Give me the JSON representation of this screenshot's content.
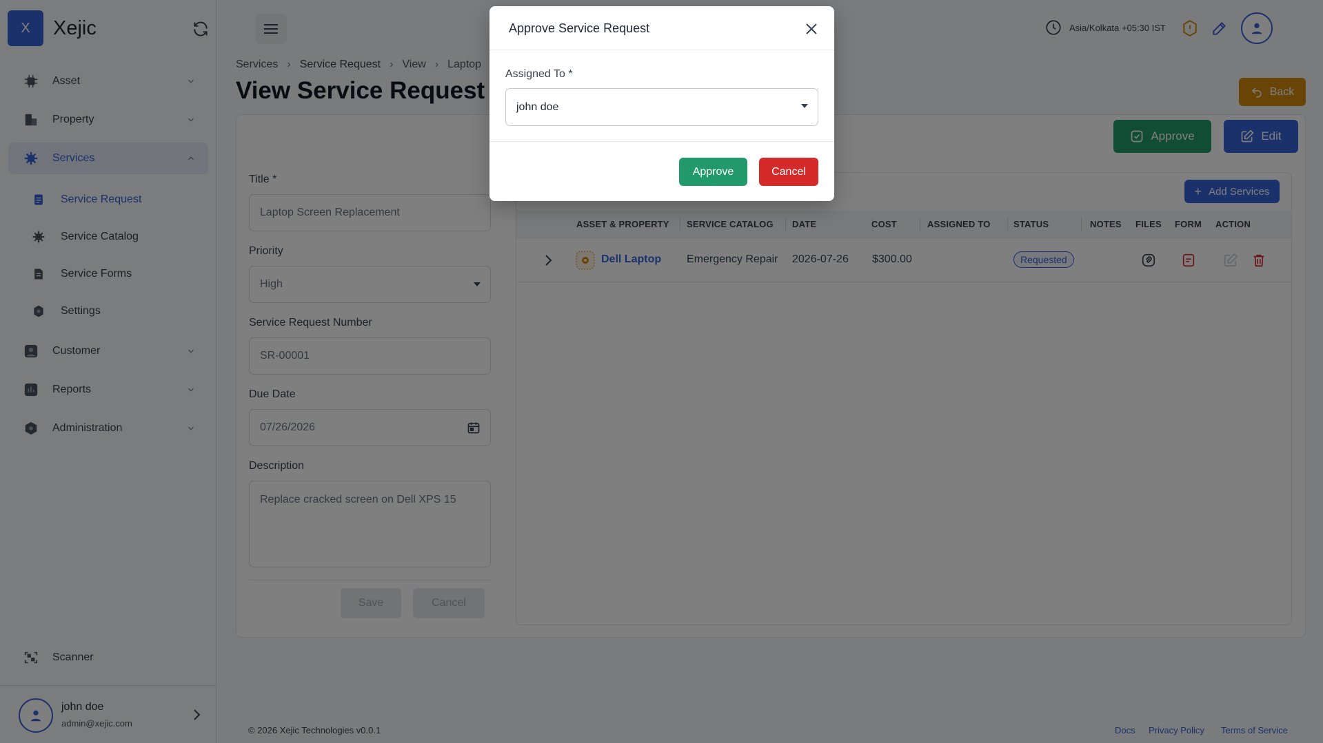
{
  "app": {
    "name": "Xejic",
    "logo_letter": "X"
  },
  "sidebar": {
    "items": [
      {
        "label": "Asset",
        "icon": "chip-icon"
      },
      {
        "label": "Property",
        "icon": "building-icon"
      },
      {
        "label": "Services",
        "icon": "gear-icon",
        "active": true
      },
      {
        "label": "Customer",
        "icon": "user-icon"
      },
      {
        "label": "Reports",
        "icon": "chart-icon"
      },
      {
        "label": "Administration",
        "icon": "shield-icon"
      },
      {
        "label": "Scanner",
        "icon": "scan-icon"
      }
    ],
    "subitems": [
      {
        "label": "Service Request",
        "active": true
      },
      {
        "label": "Service Catalog"
      },
      {
        "label": "Service Forms"
      },
      {
        "label": "Settings"
      }
    ],
    "profile": {
      "name": "john doe",
      "email": "admin@xejic.com"
    }
  },
  "header": {
    "timezone": "Asia/Kolkata +05:30 IST"
  },
  "breadcrumb": [
    "Services",
    "Service Request",
    "View",
    "Laptop"
  ],
  "page": {
    "title": "View Service Request",
    "back_label": "Back",
    "approve_label": "Approve",
    "edit_label": "Edit"
  },
  "form": {
    "title_label": "Title *",
    "title_value": "Laptop Screen Replacement",
    "priority_label": "Priority",
    "priority_value": "High",
    "number_label": "Service Request Number",
    "number_value": "SR-00001",
    "due_label": "Due Date",
    "due_value": "07/26/2026",
    "desc_label": "Description",
    "desc_value": "Replace cracked screen on Dell XPS 15",
    "save_label": "Save",
    "cancel_label": "Cancel"
  },
  "services": {
    "add_label": "Add Services",
    "columns": [
      "ASSET & PROPERTY",
      "SERVICE CATALOG",
      "DATE",
      "COST",
      "ASSIGNED TO",
      "STATUS",
      "NOTES",
      "FILES",
      "FORM",
      "ACTION"
    ],
    "rows": [
      {
        "asset": "Dell Laptop",
        "catalog": "Emergency Repair",
        "date": "2026-07-26",
        "cost": "$300.00",
        "assigned": "",
        "status": "Requested"
      }
    ]
  },
  "footer": {
    "copyright": "© 2026 Xejic Technologies v0.0.1",
    "links": [
      "Docs",
      "Privacy Policy",
      "Terms of Service"
    ]
  },
  "modal": {
    "title": "Approve Service Request",
    "assigned_label": "Assigned To *",
    "assigned_value": "john doe",
    "approve_label": "Approve",
    "cancel_label": "Cancel"
  },
  "colors": {
    "primary": "#3563d6",
    "success": "#22996a",
    "danger": "#d42a2a",
    "warning": "#d08a0c"
  }
}
